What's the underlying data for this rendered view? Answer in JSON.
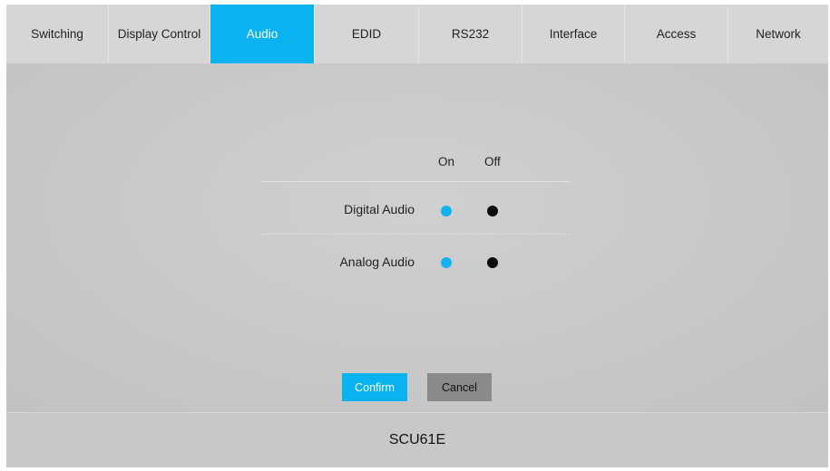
{
  "tabs": [
    {
      "label": "Switching",
      "active": false
    },
    {
      "label": "Display Control",
      "active": false
    },
    {
      "label": "Audio",
      "active": true
    },
    {
      "label": "EDID",
      "active": false
    },
    {
      "label": "RS232",
      "active": false
    },
    {
      "label": "Interface",
      "active": false
    },
    {
      "label": "Access",
      "active": false
    },
    {
      "label": "Network",
      "active": false
    }
  ],
  "audio": {
    "columns": {
      "on": "On",
      "off": "Off"
    },
    "rows": [
      {
        "label": "Digital Audio"
      },
      {
        "label": "Analog Audio"
      }
    ]
  },
  "buttons": {
    "confirm": "Confirm",
    "cancel": "Cancel"
  },
  "footer": {
    "device_name": "SCU61E"
  },
  "colors": {
    "accent": "#08b3f0",
    "radio_on": "#12b2ef",
    "radio_off": "#0a0a0a",
    "cancel_bg": "#8a8a8a"
  }
}
